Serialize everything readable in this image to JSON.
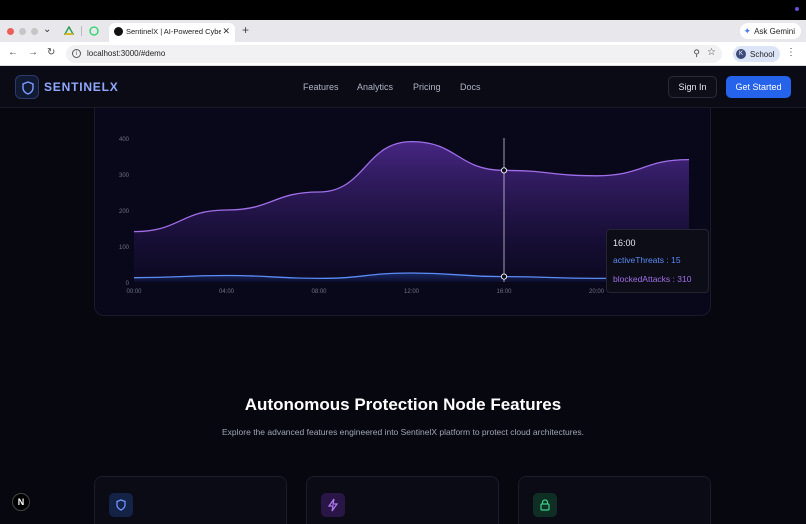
{
  "browser": {
    "tab_title": "SentinelX | AI-Powered Cyber",
    "url": "localhost:3000/#demo",
    "ask_gemini": "Ask Gemini",
    "profile_label": "School",
    "profile_initial": "K"
  },
  "header": {
    "brand": "SENTINELX",
    "nav": [
      "Features",
      "Analytics",
      "Pricing",
      "Docs"
    ],
    "signin": "Sign In",
    "cta": "Get Started"
  },
  "chart_data": {
    "type": "area",
    "x": [
      "00:00",
      "04:00",
      "08:00",
      "12:00",
      "16:00",
      "20:00",
      "24:00"
    ],
    "yticks": [
      0,
      100,
      200,
      300,
      400
    ],
    "ylim": [
      0,
      400
    ],
    "series": [
      {
        "name": "blockedAttacks",
        "values": [
          140,
          200,
          250,
          390,
          310,
          295,
          340
        ],
        "color": "#a06ee8"
      },
      {
        "name": "activeThreats",
        "values": [
          12,
          18,
          10,
          25,
          15,
          10,
          16
        ],
        "color": "#5b8cf5"
      }
    ],
    "grid": false
  },
  "tooltip": {
    "time": "16:00",
    "line_a": "activeThreats : 15",
    "line_b": "blockedAttacks : 310"
  },
  "features": {
    "title": "Autonomous Protection Node Features",
    "subtitle": "Explore the advanced features engineered into SentinelX platform to protect cloud architectures."
  }
}
